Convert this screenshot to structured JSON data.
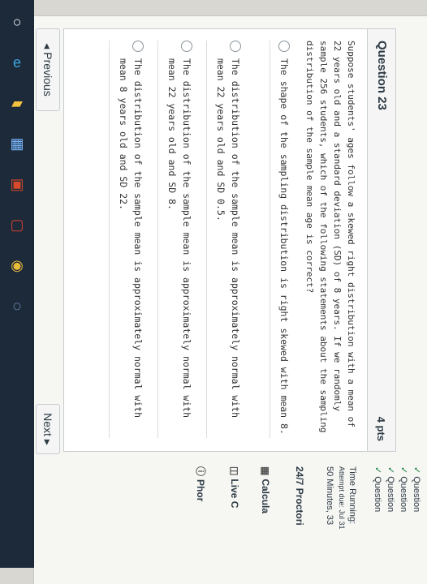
{
  "question": {
    "title": "Question 23",
    "points": "4 pts",
    "text": "Suppose students' ages follow a skewed right distribution with a mean of 22 years old and a standard deviation (SD) of 8 years. If we randomly sample 256 students, which of the following statements about the sampling distribution of the sample mean age is correct?",
    "options": [
      "The shape of the sampling distribution is right skewed with mean 8.",
      "The distribution of the sample mean is approximately normal with mean 22 years old and SD 0.5.",
      "The distribution of the sample mean is approximately normal with mean 22 years old and SD 8.",
      "The distribution of the sample mean is approximately normal with mean 8 years old and SD 22."
    ]
  },
  "nav": {
    "previous_label": "Previous",
    "next_label": "Next",
    "previous_arrow": "◂",
    "next_arrow": "▸"
  },
  "sidebar": {
    "questions": [
      "Question",
      "Question",
      "Question",
      "Question"
    ],
    "time_running": "Time Running:",
    "attempt_due": "Attempt due: Jul 31",
    "minutes": "50 Minutes, 33",
    "proctor": "24/7 Proctori",
    "calculator": "Calcula",
    "live_chat": "Live C",
    "phone": "Phor"
  },
  "taskbar": {
    "icons": [
      "start-circle-icon",
      "edge-icon",
      "file-explorer-icon",
      "store-icon",
      "office-icon",
      "calendar-icon",
      "chrome-icon",
      "assistant-icon"
    ]
  },
  "colors": {
    "page_bg": "#f6f6f3",
    "card_border": "#c7cdd1",
    "taskbar": "#1d2a3a",
    "check_green": "#0a7a38"
  }
}
